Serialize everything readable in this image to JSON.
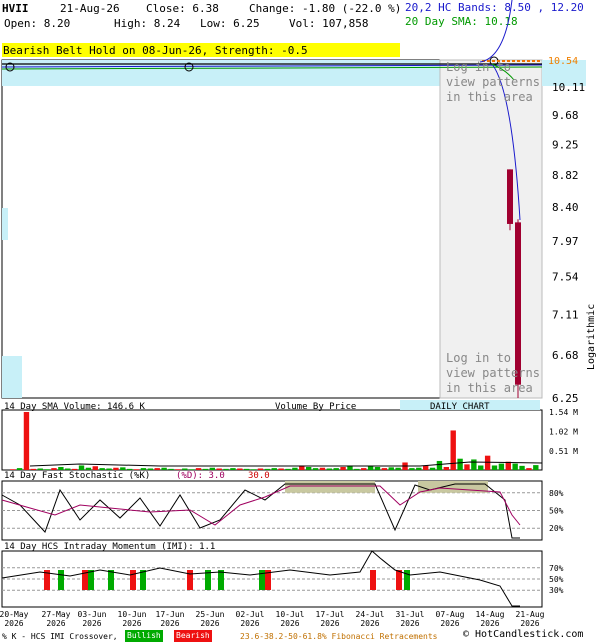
{
  "header": {
    "symbol": "HVII",
    "date": "21-Aug-26",
    "close_label": "Close: 6.38",
    "change_label": "Change: -1.80 (-22.0 %)",
    "open_label": "Open: 8.20",
    "high_label": "High: 8.24",
    "low_label": "Low: 6.25",
    "vol_label": "Vol: 107,858",
    "hc_bands_label": "20,2 HC Bands: 8.50 , 12.20",
    "sma_label": "20 Day SMA: 10.18"
  },
  "banner": "Bearish Belt Hold on 08-Jun-26, Strength: -0.5",
  "price_axis_ticks": [
    "10.11",
    "9.68",
    "9.25",
    "8.82",
    "8.40",
    "7.97",
    "7.54",
    "7.11",
    "6.68",
    "6.25"
  ],
  "price_axis_top": "10.54",
  "log_label": "Logarithmic",
  "overlay_text": "Log in to view patterns in this area",
  "volume_panel": {
    "title": "14 Day SMA Volume: 146.6 K",
    "vbp_label": "Volume By Price",
    "daily_label": "DAILY CHART",
    "ticks": [
      "1.54 M",
      "1.02 M",
      "0.51 M"
    ]
  },
  "stoch_panel": {
    "title": "14 Day Fast Stochastic (%K)",
    "d_label": "(%D): 3.0",
    "d_value": "30.0",
    "ticks": [
      "80%",
      "50%",
      "20%"
    ]
  },
  "imi_panel": {
    "title": "14 Day HCS Intraday Momentum (IMI): 1.1",
    "ticks": [
      "70%",
      "50%",
      "30%"
    ]
  },
  "x_dates": [
    {
      "d": "20-May",
      "y": "2026"
    },
    {
      "d": "27-May",
      "y": "2026"
    },
    {
      "d": "03-Jun",
      "y": "2026"
    },
    {
      "d": "10-Jun",
      "y": "2026"
    },
    {
      "d": "17-Jun",
      "y": "2026"
    },
    {
      "d": "25-Jun",
      "y": "2026"
    },
    {
      "d": "02-Jul",
      "y": "2026"
    },
    {
      "d": "10-Jul",
      "y": "2026"
    },
    {
      "d": "17-Jul",
      "y": "2026"
    },
    {
      "d": "24-Jul",
      "y": "2026"
    },
    {
      "d": "31-Jul",
      "y": "2026"
    },
    {
      "d": "07-Aug",
      "y": "2026"
    },
    {
      "d": "14-Aug",
      "y": "2026"
    },
    {
      "d": "21-Aug",
      "y": "2026"
    }
  ],
  "footer": {
    "legend": "% K - HCS IMI Crossover,",
    "bullish": "Bullish",
    "bearish": "Bearish",
    "fib": "23.6-38.2-50-61.8% Fibonacci Retracements",
    "brand": "© HotCandlestick.com"
  },
  "colors": {
    "bull": "#00aa00",
    "bear": "#ee1111",
    "candle": "#a00030",
    "sma": "#009900",
    "band": "#1a1acc",
    "fill": "#c8f0f8"
  },
  "chart_data": [
    {
      "type": "candlestick",
      "title": "",
      "scale": "log",
      "ylim": [
        6.25,
        10.54
      ],
      "candles": [
        {
          "date": "20-Aug-26",
          "open": 8.9,
          "high": 8.9,
          "low": 8.1,
          "close": 8.18
        },
        {
          "date": "21-Aug-26",
          "open": 8.2,
          "high": 8.24,
          "low": 6.25,
          "close": 6.38
        }
      ]
    },
    {
      "type": "bar",
      "title": "14 Day SMA Volume: 146.6 K",
      "ylim": [
        0,
        1.54
      ],
      "unit": "M",
      "values": [
        0.02,
        0.05,
        1.54,
        0.03,
        0.04,
        0.02,
        0.05,
        0.08,
        0.04,
        0.03,
        0.12,
        0.06,
        0.1,
        0.05,
        0.04,
        0.06,
        0.07,
        0.03,
        0.02,
        0.05,
        0.04,
        0.05,
        0.06,
        0.03,
        0.02,
        0.04,
        0.02,
        0.05,
        0.03,
        0.06,
        0.04,
        0.03,
        0.05,
        0.04,
        0.03,
        0.02,
        0.04,
        0.03,
        0.05,
        0.04,
        0.03,
        0.06,
        0.12,
        0.08,
        0.05,
        0.06,
        0.04,
        0.05,
        0.08,
        0.12,
        0.03,
        0.05,
        0.1,
        0.08,
        0.05,
        0.07,
        0.06,
        0.2,
        0.05,
        0.06,
        0.12,
        0.06,
        0.24,
        0.08,
        1.05,
        0.3,
        0.15,
        0.28,
        0.12,
        0.38,
        0.12,
        0.17,
        0.22,
        0.17,
        0.11,
        0.05,
        0.13
      ]
    }
  ]
}
